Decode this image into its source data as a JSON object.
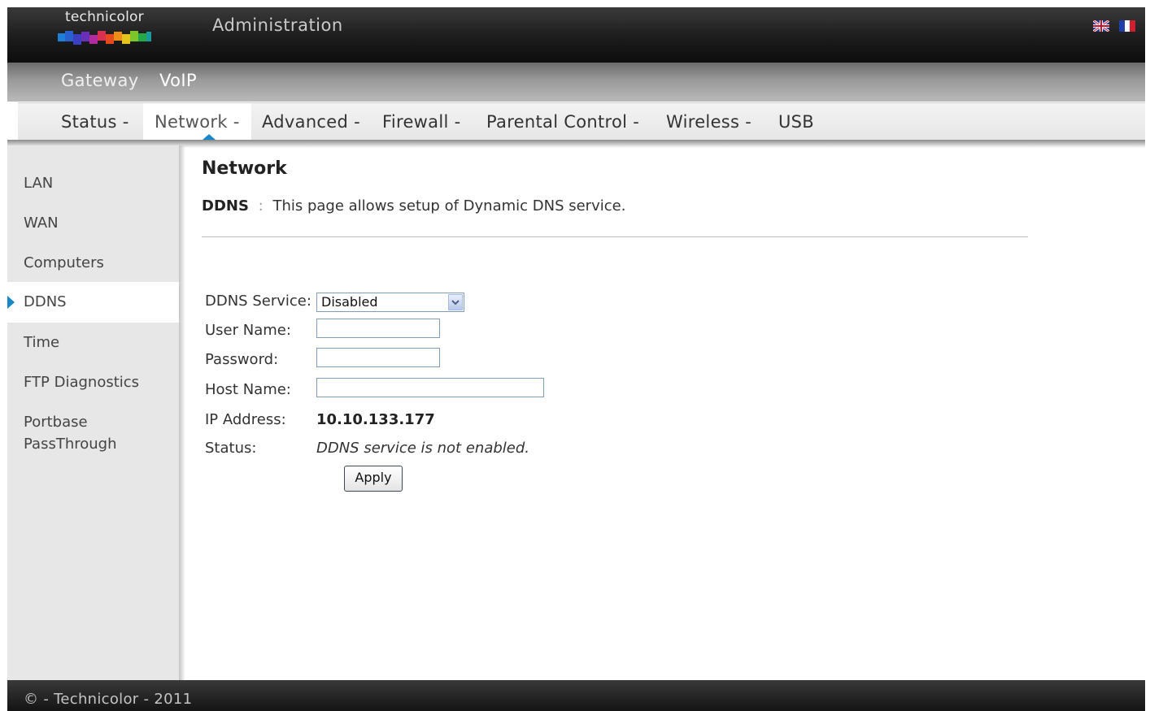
{
  "header": {
    "brand": "technicolor",
    "title": "Administration",
    "flags": [
      "uk-flag-icon",
      "fr-flag-icon"
    ]
  },
  "main_nav": {
    "items": [
      {
        "label": "Gateway"
      },
      {
        "label": "VoIP"
      }
    ]
  },
  "sub_nav": {
    "items": [
      {
        "label": "Status -"
      },
      {
        "label": "Network -",
        "active": true
      },
      {
        "label": "Advanced -"
      },
      {
        "label": "Firewall -"
      },
      {
        "label": "Parental Control -"
      },
      {
        "label": "Wireless -"
      },
      {
        "label": "USB"
      }
    ]
  },
  "sidebar": {
    "items": [
      {
        "label": "LAN"
      },
      {
        "label": "WAN"
      },
      {
        "label": "Computers"
      },
      {
        "label": "DDNS",
        "active": true
      },
      {
        "label": "Time"
      },
      {
        "label": "FTP Diagnostics"
      },
      {
        "label_line1": "Portbase",
        "label_line2": "PassThrough"
      }
    ]
  },
  "content": {
    "title": "Network",
    "desc_key": "DDNS",
    "desc_sep": ":",
    "desc_text": "This page allows setup of Dynamic DNS service.",
    "form": {
      "service_label": "DDNS Service:",
      "service_value": "Disabled",
      "username_label": "User Name:",
      "username_value": "",
      "password_label": "Password:",
      "password_value": "",
      "hostname_label": "Host Name:",
      "hostname_value": "",
      "ip_label": "IP Address:",
      "ip_value": "10.10.133.177",
      "status_label": "Status:",
      "status_value": "DDNS service is not enabled.",
      "apply_label": "Apply"
    }
  },
  "footer": {
    "text": "© - Technicolor - 2011"
  },
  "colors": {
    "accent": "#1a86c8",
    "header_bg": "#1c1c1c",
    "sidebar_bg": "#e7e7e7"
  }
}
